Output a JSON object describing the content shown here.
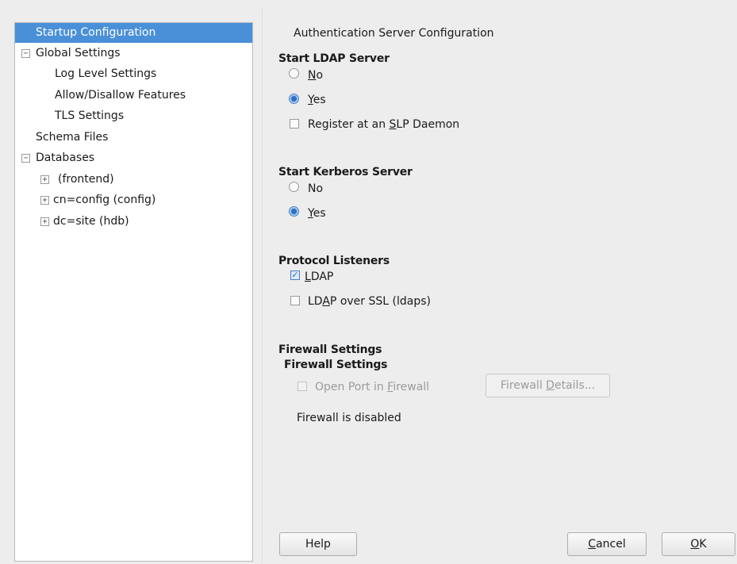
{
  "sidebar": {
    "items": [
      {
        "label": "Startup Configuration"
      },
      {
        "label": "Global Settings",
        "expander": "⊟"
      },
      {
        "label": "Log Level Settings"
      },
      {
        "label": "Allow/Disallow Features"
      },
      {
        "label": "TLS Settings"
      },
      {
        "label": "Schema Files"
      },
      {
        "label": "Databases",
        "expander": "⊟"
      },
      {
        "label": "(frontend)",
        "expander": "⊞"
      },
      {
        "label": "cn=config (config)",
        "expander": "⊞"
      },
      {
        "label": "dc=site (hdb)",
        "expander": "⊞"
      }
    ]
  },
  "main": {
    "title": "Authentication Server Configuration",
    "ldap": {
      "heading": "Start LDAP Server",
      "no": {
        "mnemonic": "N",
        "rest": "o"
      },
      "yes": {
        "mnemonic": "Y",
        "rest": "es"
      },
      "slp": {
        "before": "Register at an ",
        "mnemonic": "S",
        "after": "LP Daemon"
      }
    },
    "kerberos": {
      "heading": "Start Kerberos Server",
      "no": "No",
      "yes": {
        "mnemonic": "Y",
        "rest": "es"
      }
    },
    "listeners": {
      "heading": "Protocol Listeners",
      "ldap": {
        "mnemonic": "L",
        "rest": "DAP"
      },
      "ldaps": {
        "before": "LD",
        "mnemonic": "A",
        "after": "P over SSL (ldaps)"
      }
    },
    "firewall": {
      "heading": "Firewall Settings",
      "subheading": "Firewall Settings",
      "open_port": {
        "before": "Open Port in ",
        "mnemonic": "F",
        "after": "irewall"
      },
      "details": {
        "before": "Firewall ",
        "mnemonic": "D",
        "after": "etails..."
      },
      "status": "Firewall is disabled"
    }
  },
  "buttons": {
    "help": "Help",
    "cancel": {
      "mnemonic": "C",
      "rest": "ancel"
    },
    "ok": {
      "mnemonic": "O",
      "rest": "K"
    }
  },
  "state": {
    "ldap_server": "yes",
    "kerberos_server": "yes",
    "register_slp": false,
    "listener_ldap": true,
    "listener_ldaps": false,
    "open_port_firewall": false
  },
  "colors": {
    "selection": "#4a90d9",
    "accent": "#2f6fc4"
  }
}
